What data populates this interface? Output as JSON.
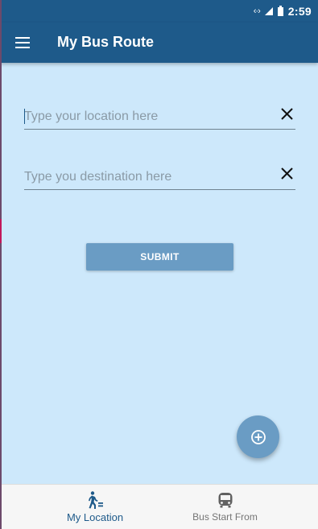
{
  "status_bar": {
    "time": "2:59",
    "data_icon": "data-transfer-icon",
    "signal_icon": "signal-icon",
    "battery_icon": "battery-icon"
  },
  "app_bar": {
    "title": "My Bus Route",
    "menu_icon": "hamburger-menu-icon"
  },
  "form": {
    "location": {
      "placeholder": "Type your location here",
      "value": "",
      "clear_icon": "close-icon"
    },
    "destination": {
      "placeholder": "Type you destination here",
      "value": "",
      "clear_icon": "close-icon"
    },
    "submit_label": "SUBMIT"
  },
  "fab": {
    "icon": "add-circle-icon"
  },
  "bottom_nav": {
    "items": [
      {
        "label": "My Location",
        "icon": "walking-person-icon",
        "active": true
      },
      {
        "label": "Bus Start From",
        "icon": "bus-icon",
        "active": false
      }
    ]
  },
  "colors": {
    "primary": "#1e5a8a",
    "background": "#cde8fb",
    "accent_button": "#6a9cc4",
    "nav_background": "#f6f6f6"
  }
}
